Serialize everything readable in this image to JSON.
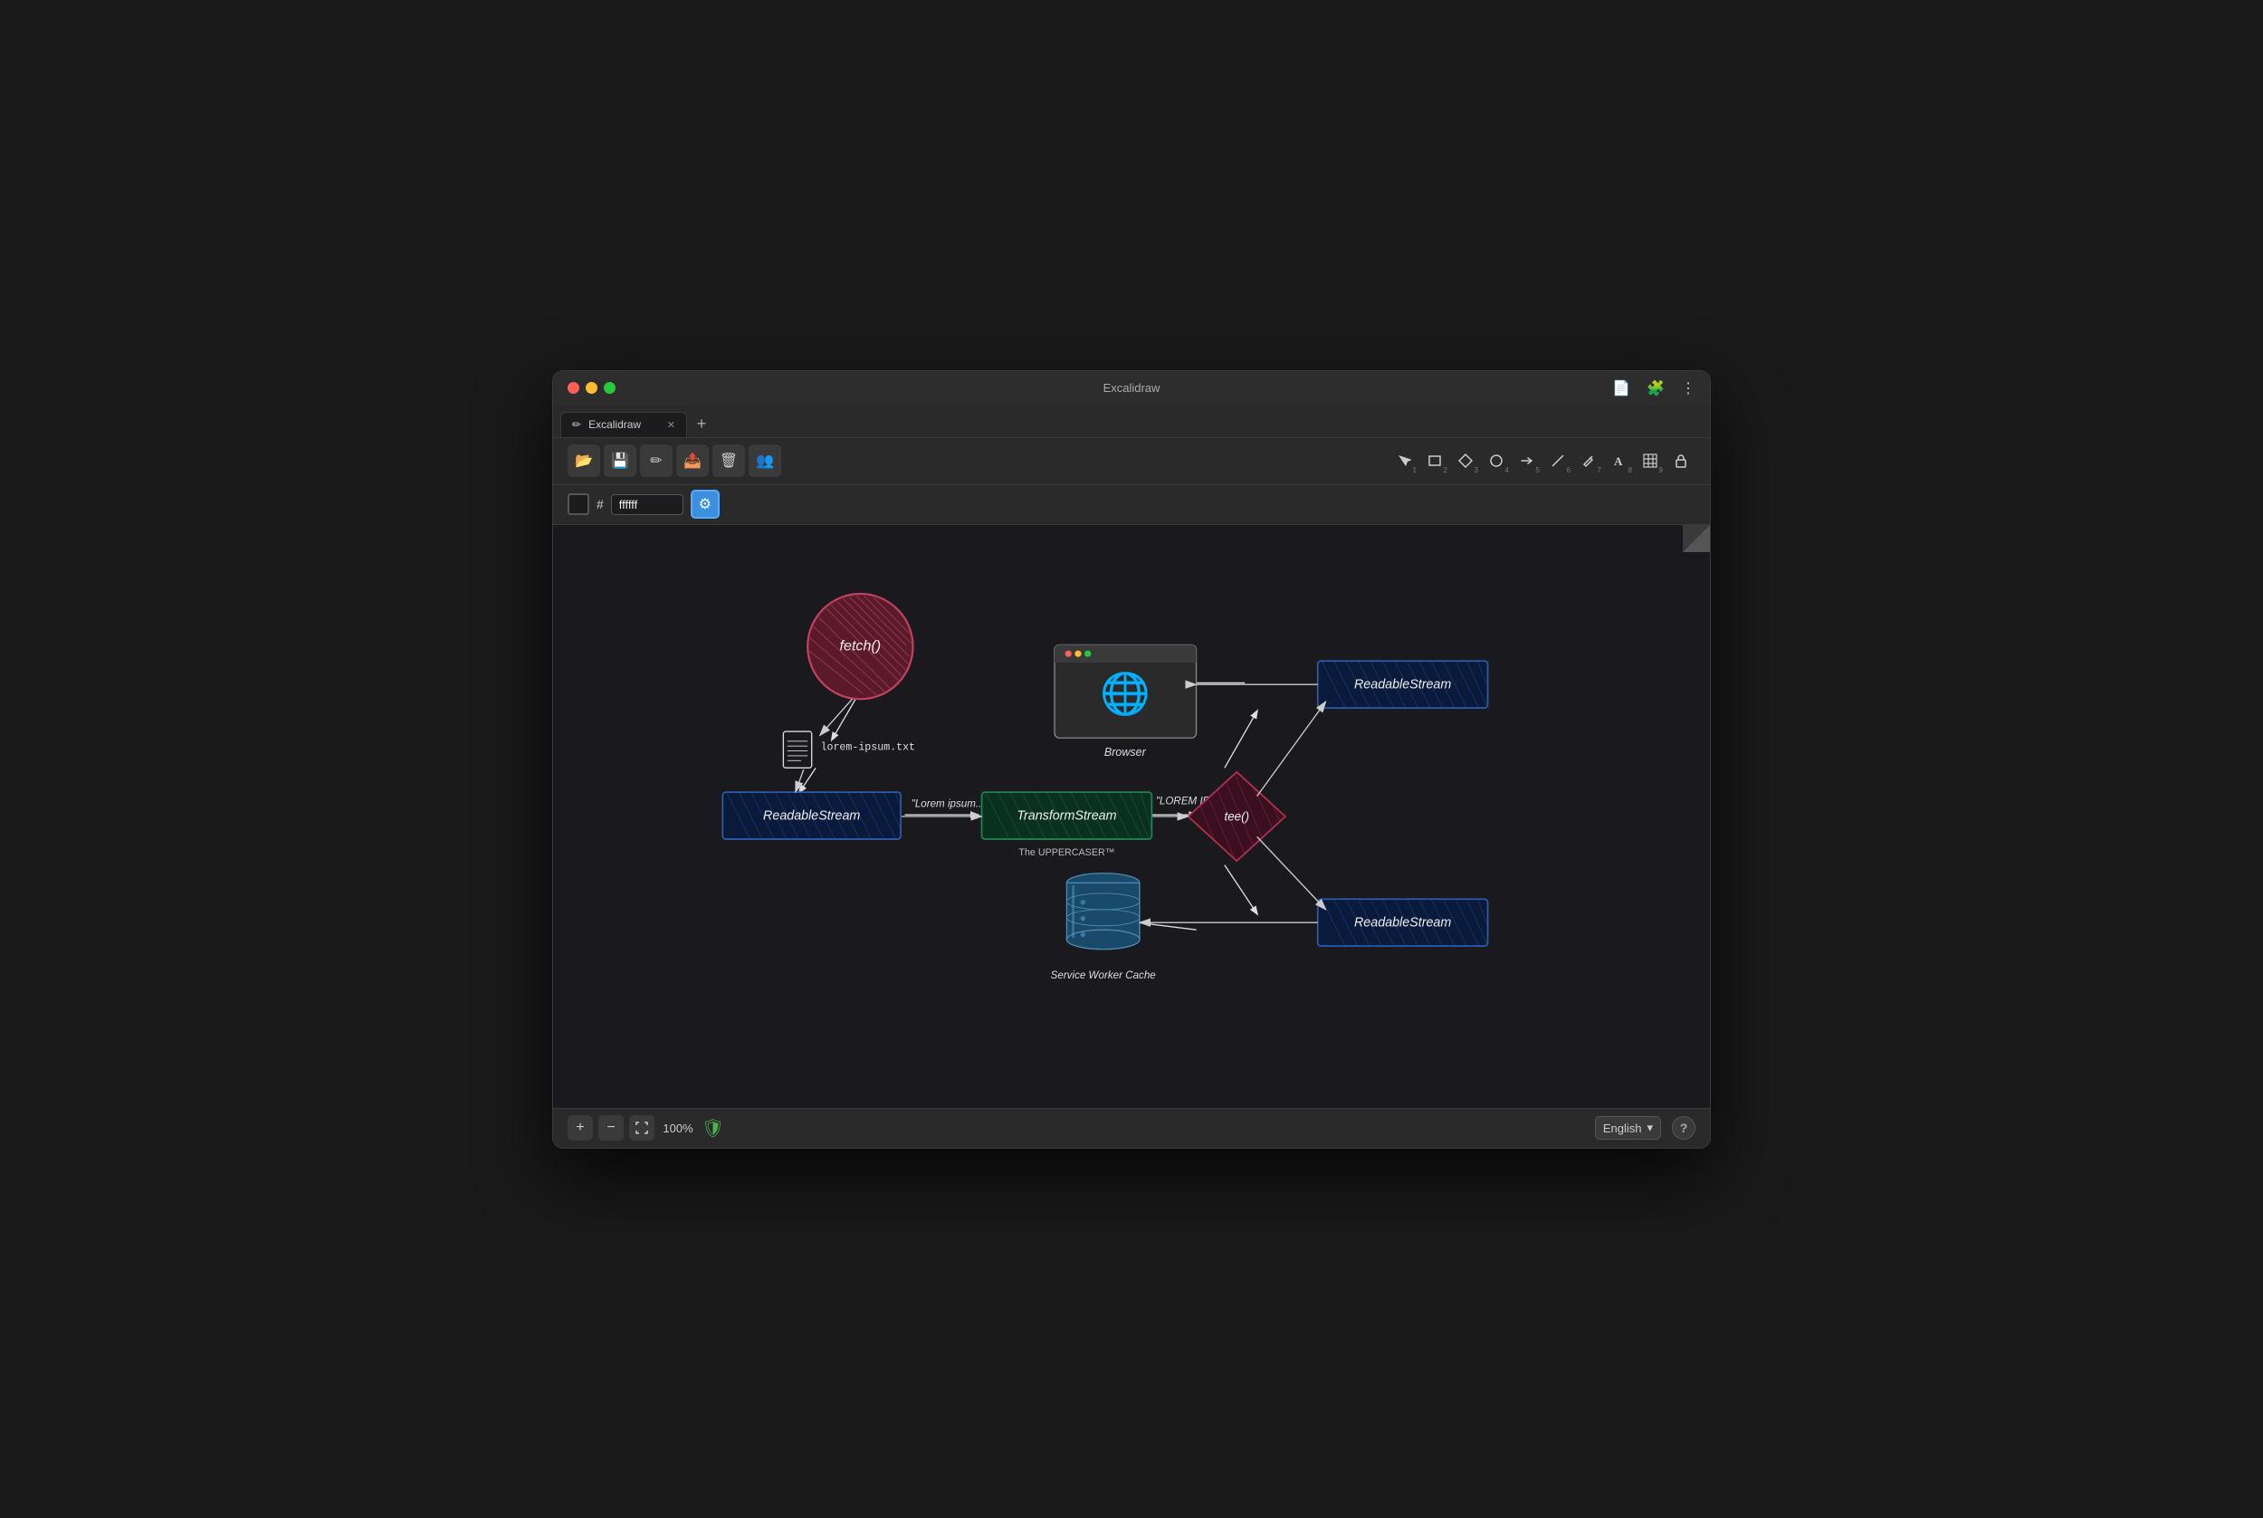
{
  "window": {
    "title": "Excalidraw",
    "tab_label": "Excalidraw"
  },
  "toolbar": {
    "tools": [
      {
        "name": "select",
        "icon": "↖",
        "num": "1"
      },
      {
        "name": "rectangle",
        "icon": "□",
        "num": "2"
      },
      {
        "name": "diamond",
        "icon": "◇",
        "num": "3"
      },
      {
        "name": "ellipse",
        "icon": "○",
        "num": "4"
      },
      {
        "name": "arrow",
        "icon": "→",
        "num": "5"
      },
      {
        "name": "line",
        "icon": "—",
        "num": "6"
      },
      {
        "name": "pencil",
        "icon": "✏",
        "num": "7"
      },
      {
        "name": "text",
        "icon": "A",
        "num": "8"
      },
      {
        "name": "table",
        "icon": "⊞",
        "num": "9"
      },
      {
        "name": "lock",
        "icon": "🔒",
        "num": ""
      }
    ],
    "file_tools": [
      "📂",
      "💾",
      "✏",
      "📤",
      "🗑",
      "👥"
    ]
  },
  "color": {
    "hex_value": "ffffff"
  },
  "zoom": {
    "level": "100%"
  },
  "language": {
    "selected": "English"
  },
  "diagram": {
    "nodes": [
      {
        "id": "fetch",
        "label": "fetch()"
      },
      {
        "id": "readable-left",
        "label": "ReadableStream"
      },
      {
        "id": "transform",
        "label": "TransformStream"
      },
      {
        "id": "transform-sub",
        "label": "The UPPERCASER™"
      },
      {
        "id": "tee",
        "label": "tee()"
      },
      {
        "id": "readable-top-right",
        "label": "ReadableStream"
      },
      {
        "id": "readable-bottom-right",
        "label": "ReadableStream"
      },
      {
        "id": "browser",
        "label": "Browser"
      },
      {
        "id": "service-worker",
        "label": "Service Worker Cache"
      },
      {
        "id": "lorem-file",
        "label": "lorem-ipsum.txt"
      },
      {
        "id": "lorem-flow",
        "label": "\"Lorem ipsum..\""
      },
      {
        "id": "lorem-upper",
        "label": "\"LOREM IPSUM..\""
      }
    ]
  }
}
